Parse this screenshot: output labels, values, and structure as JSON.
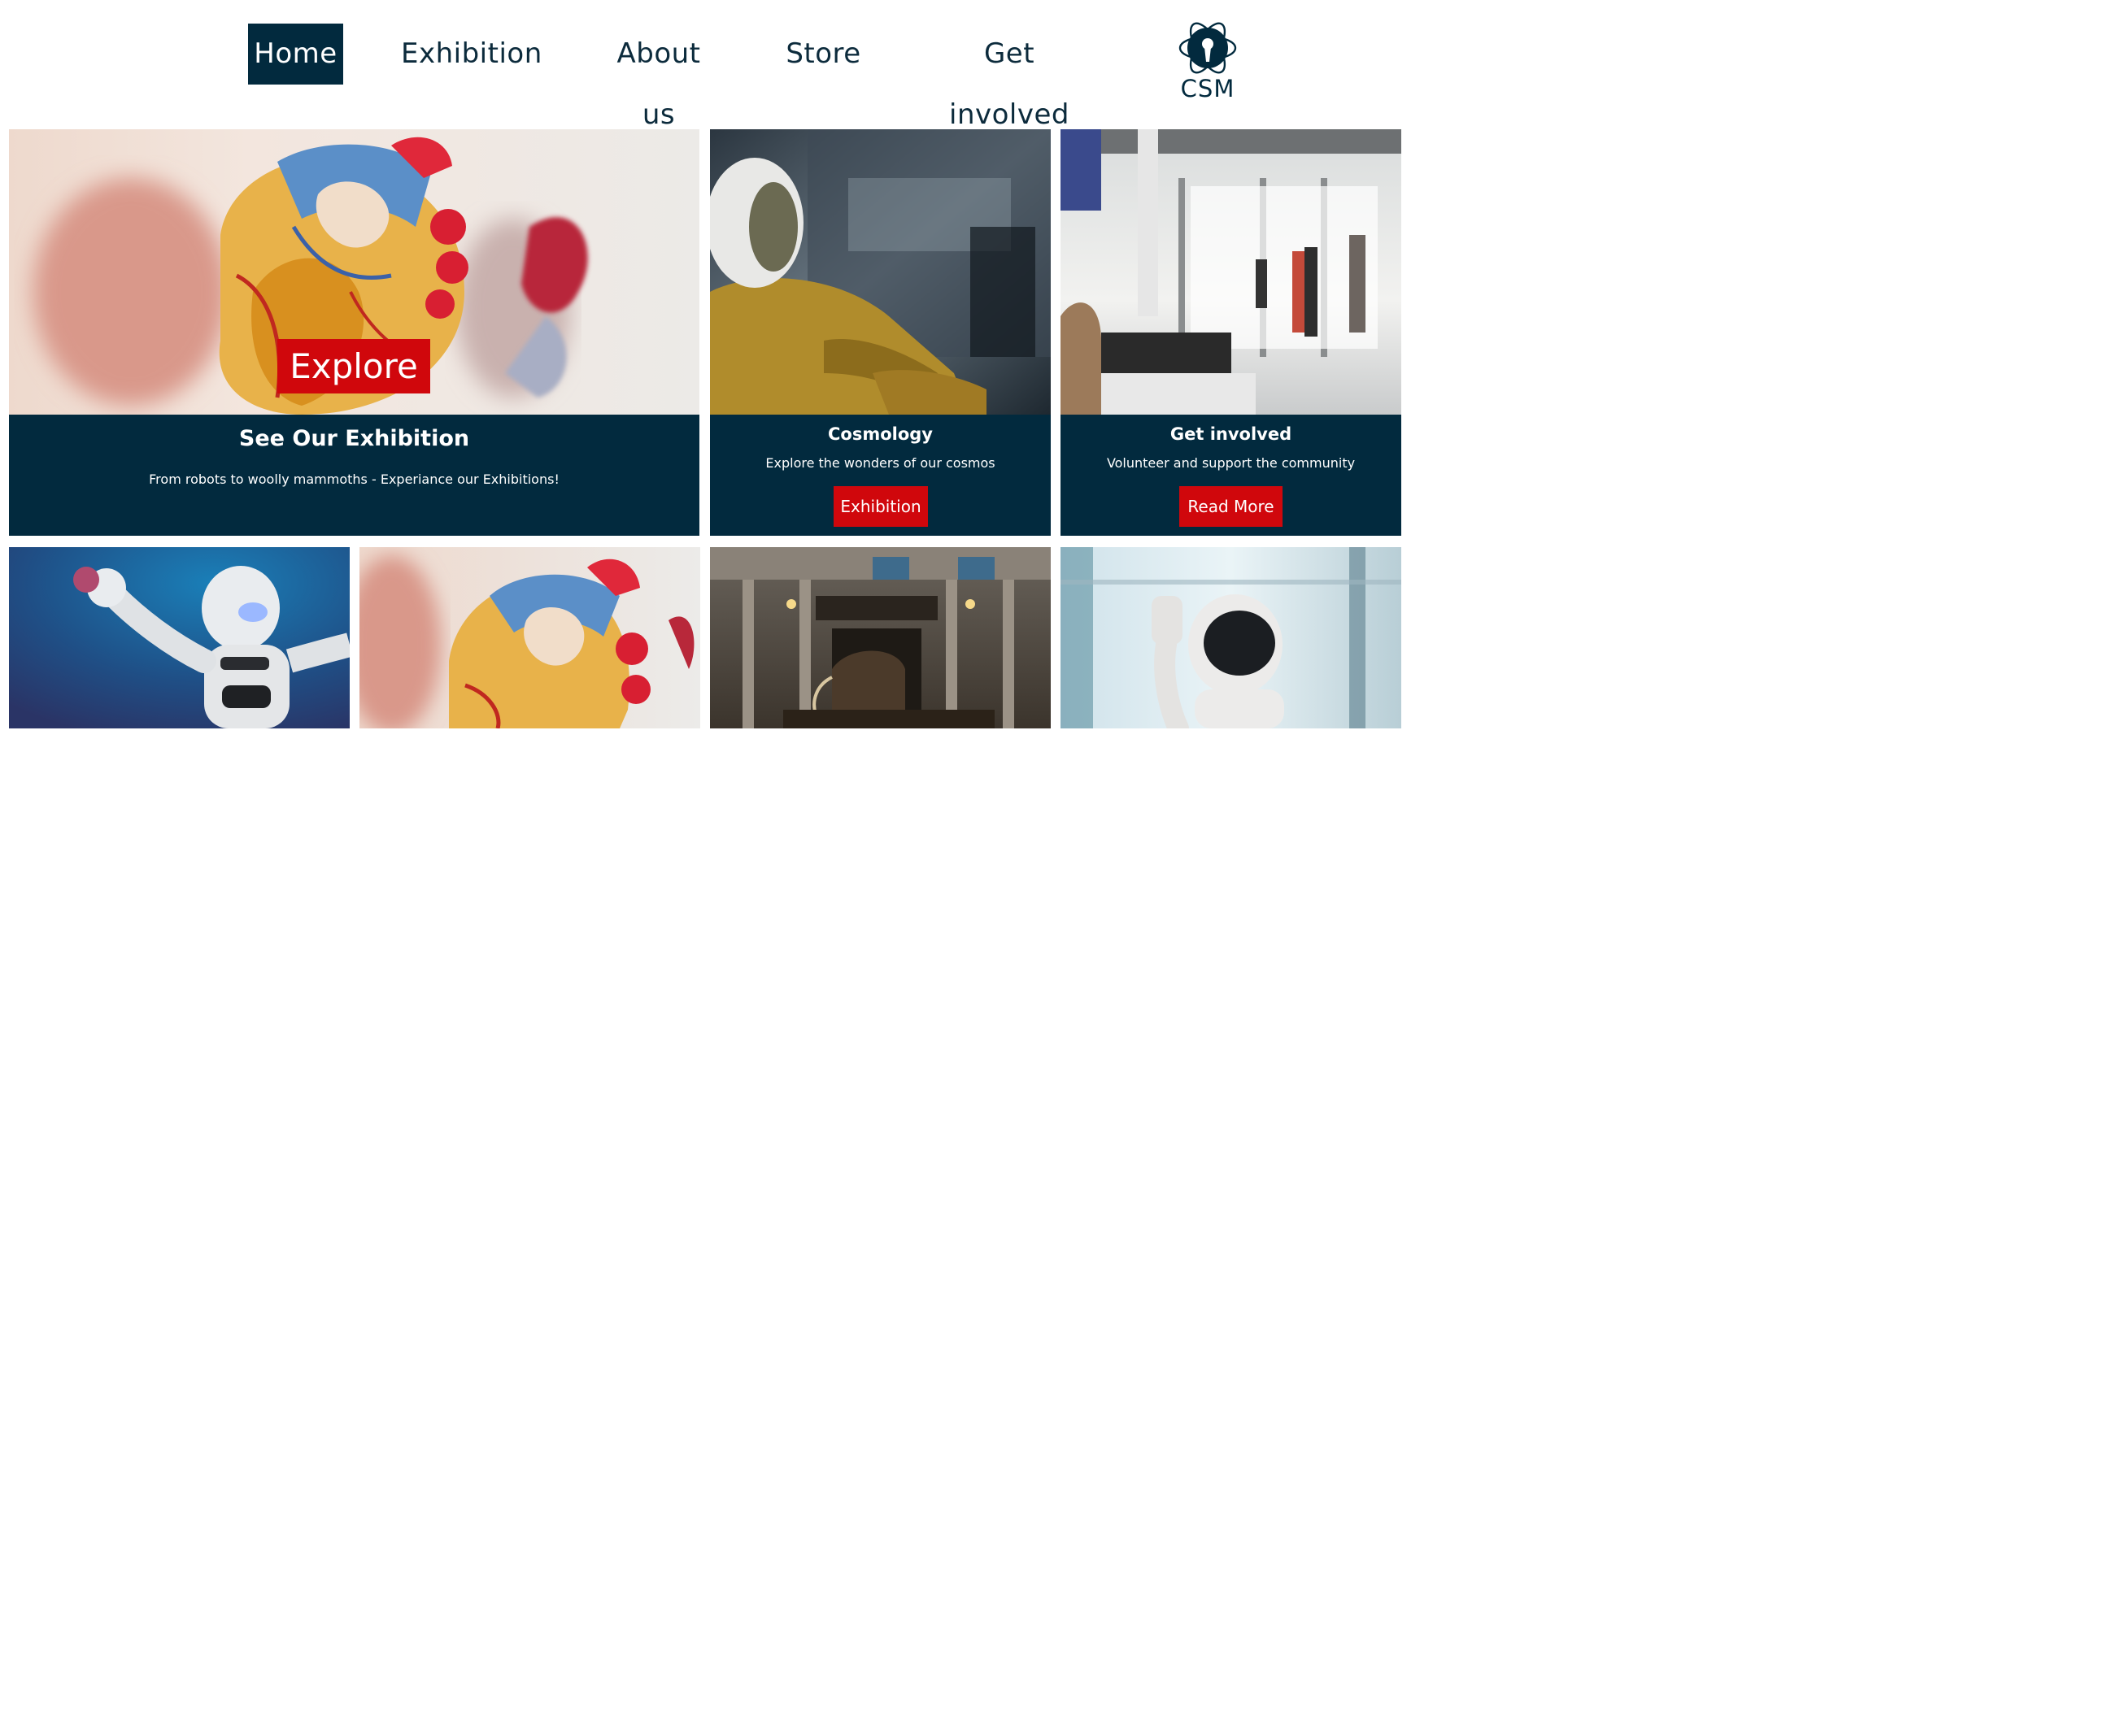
{
  "nav": {
    "items": [
      {
        "label": "Home",
        "active": true
      },
      {
        "label": "Exhibition",
        "active": false
      },
      {
        "label": "About us",
        "active": false
      },
      {
        "label": "Store",
        "active": false
      },
      {
        "label": "Get involved",
        "active": false
      }
    ],
    "logo_text": "CSM"
  },
  "hero": {
    "image": "anatomical-heart-model",
    "button_label": "Explore",
    "title": "See Our Exhibition",
    "subtitle": "From robots to woolly mammoths - Experiance our Exhibitions!"
  },
  "cards": [
    {
      "image": "astronaut-helmet",
      "title": "Cosmology",
      "subtitle": "Explore the wonders of our cosmos",
      "button_label": "Exhibition"
    },
    {
      "image": "museum-lobby-visitors",
      "title": "Get involved",
      "subtitle": "Volunteer and support the community",
      "button_label": "Read More"
    }
  ],
  "gallery": [
    {
      "image": "toy-robot-blue-background"
    },
    {
      "image": "anatomical-heart-model"
    },
    {
      "image": "museum-hall-mammoth"
    },
    {
      "image": "waving-humanoid-robot"
    }
  ],
  "colors": {
    "navy": "#022a3e",
    "red": "#d0070c",
    "white": "#ffffff"
  }
}
